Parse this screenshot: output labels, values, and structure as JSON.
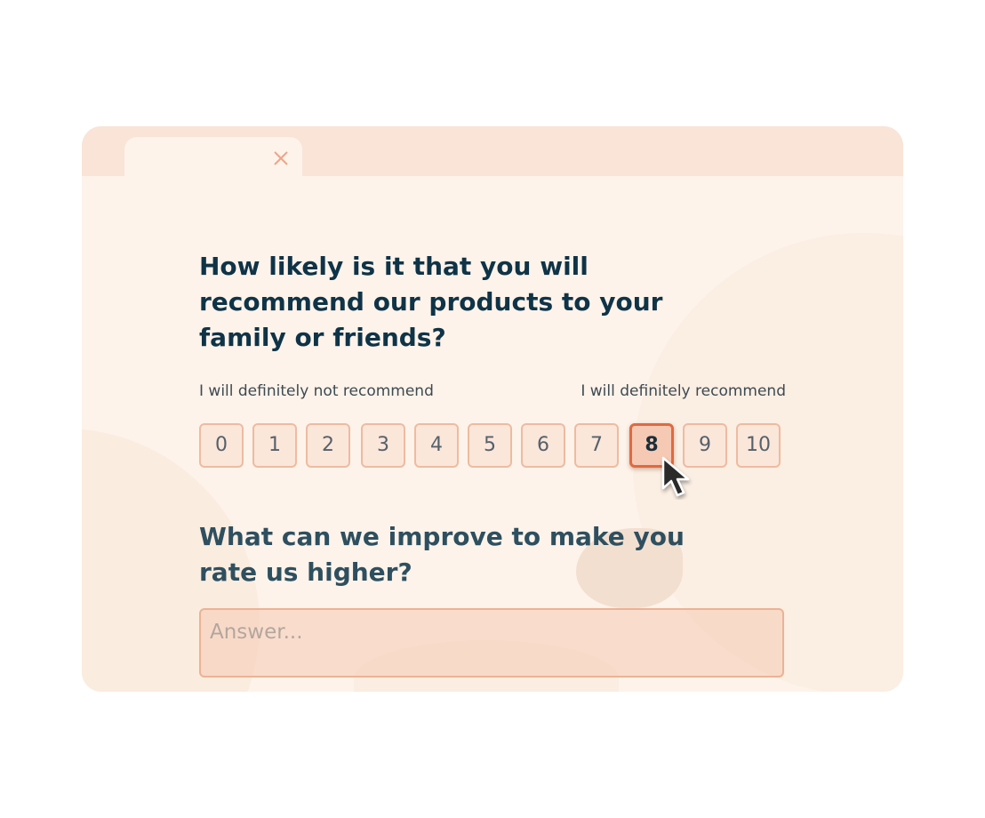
{
  "survey": {
    "question1": "How likely is it that you will recommend our products to your family or friends?",
    "scale_min_label": "I will definitely not recommend",
    "scale_max_label": "I will definitely recommend",
    "scale": [
      "0",
      "1",
      "2",
      "3",
      "4",
      "5",
      "6",
      "7",
      "8",
      "9",
      "10"
    ],
    "selected": "8",
    "question2": "What can we improve to make you rate us higher?",
    "answer_placeholder": "Answer...",
    "answer_value": ""
  },
  "icons": {
    "tab_close": "close-icon",
    "pointer": "cursor-arrow-icon"
  },
  "colors": {
    "accent": "#e06a3f",
    "button_bg": "#fbe6da",
    "button_border": "#eebba0",
    "heading": "#0f3347",
    "panel_bg": "#fdf3ea",
    "tabbar_bg": "#f9e4d7"
  }
}
